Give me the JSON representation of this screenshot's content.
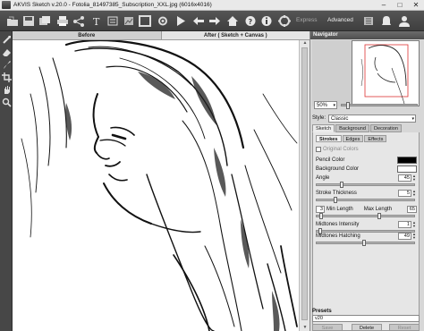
{
  "window": {
    "title": "AKVIS Sketch v.20.0 - Fotolia_81497385_Subscription_XXL.jpg (6016x4016)",
    "minimize": "–",
    "maximize": "□",
    "close": "✕"
  },
  "toolbar": {
    "mode_express": "Express",
    "mode_advanced": "Advanced"
  },
  "view_tabs": {
    "before": "Before",
    "after": "After ( Sketch + Canvas )"
  },
  "navigator": {
    "title": "Navigator",
    "zoom": "50%"
  },
  "style": {
    "label": "Style:",
    "value": "Classic"
  },
  "main_tabs": [
    "Sketch",
    "Background",
    "Decoration"
  ],
  "sub_tabs": [
    "Strokes",
    "Edges",
    "Effects"
  ],
  "params": {
    "original_colors": "Original Colors",
    "pencil_color": "Pencil Color",
    "background_color": "Background Color",
    "angle_label": "Angle",
    "angle_value": "45",
    "stroke_thickness_label": "Stroke Thickness",
    "stroke_thickness_value": "5",
    "min_length_label": "Min Length",
    "min_length_value": "3",
    "max_length_label": "Max Length",
    "max_length_value": "65",
    "midtones_intensity_label": "Midtones Intensity",
    "midtones_intensity_value": "1",
    "midtones_hatching_label": "Midtones Hatching",
    "midtones_hatching_value": "49"
  },
  "presets": {
    "title": "Presets",
    "value": "v20",
    "save": "Save",
    "delete": "Delete",
    "reset": "Reset"
  },
  "colors": {
    "pencil": "#000000",
    "background": "#ffffff",
    "dark_ui": "#3f3f3f",
    "panel": "#d7d7d7"
  }
}
